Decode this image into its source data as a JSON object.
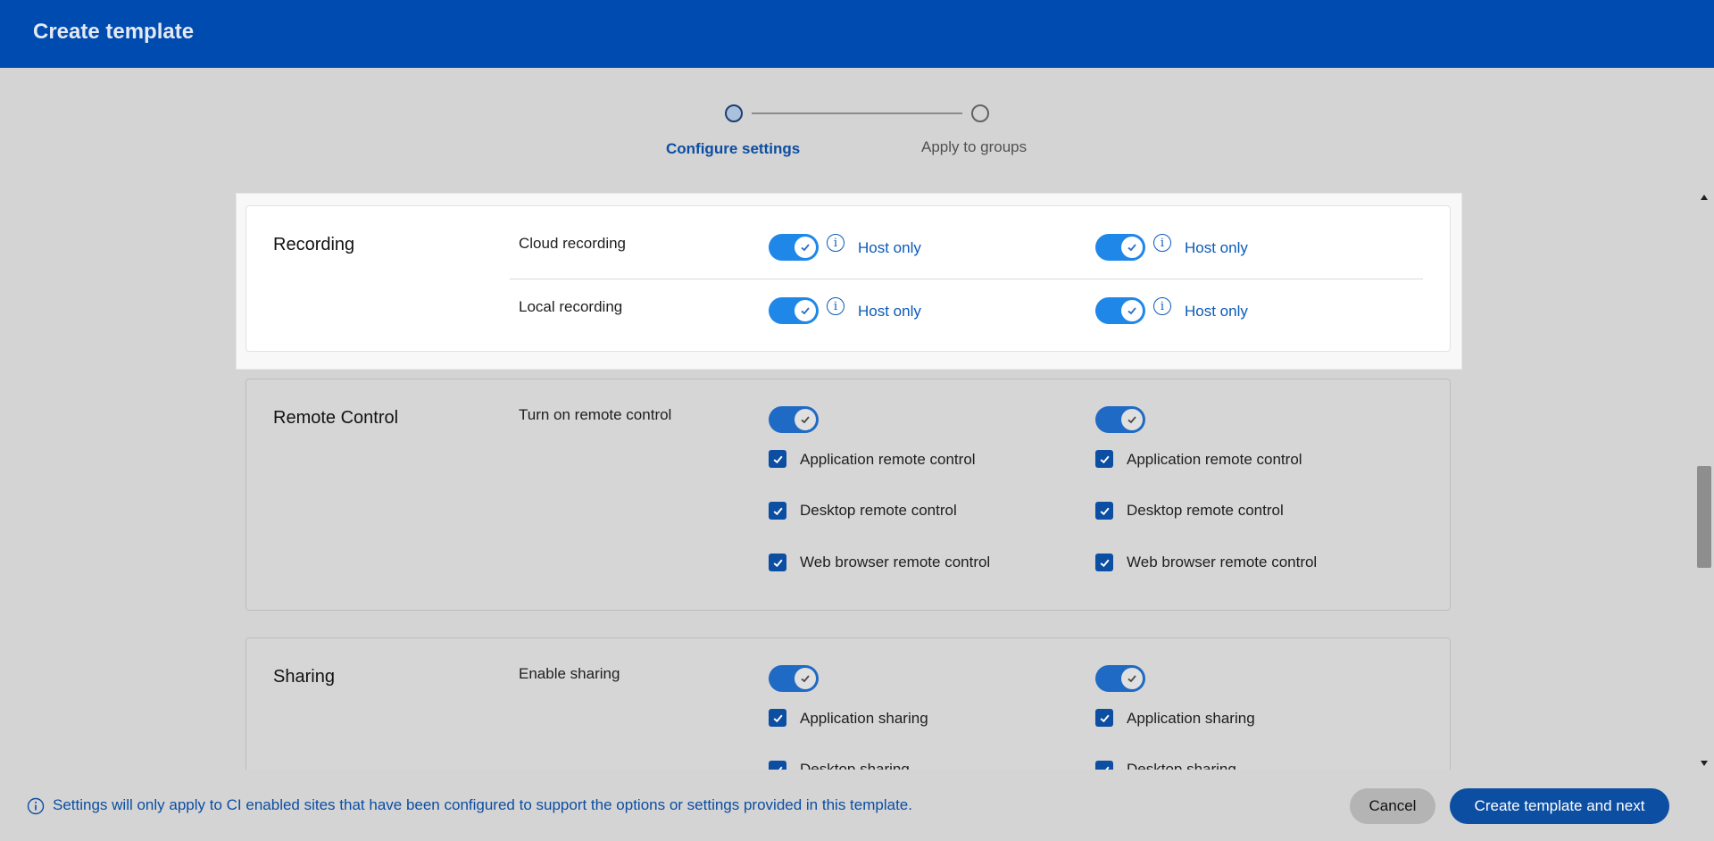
{
  "header": {
    "title": "Create template"
  },
  "stepper": {
    "steps": [
      {
        "label": "Configure settings",
        "active": true
      },
      {
        "label": "Apply to groups",
        "active": false
      }
    ]
  },
  "sections": {
    "recording": {
      "title": "Recording",
      "rows": [
        {
          "label": "Cloud recording",
          "col1": {
            "on": true,
            "link": "Host only"
          },
          "col2": {
            "on": true,
            "link": "Host only"
          }
        },
        {
          "label": "Local recording",
          "col1": {
            "on": true,
            "link": "Host only"
          },
          "col2": {
            "on": true,
            "link": "Host only"
          }
        }
      ]
    },
    "remote_control": {
      "title": "Remote Control",
      "toggle_label": "Turn on remote control",
      "options": [
        "Application remote control",
        "Desktop remote control",
        "Web browser remote control"
      ]
    },
    "sharing": {
      "title": "Sharing",
      "toggle_label": "Enable sharing",
      "options": [
        "Application sharing",
        "Desktop sharing"
      ]
    }
  },
  "footer": {
    "notice": "Settings will only apply to CI enabled sites that have been configured to support the options or settings provided in this template.",
    "cancel_label": "Cancel",
    "primary_label": "Create template and next"
  },
  "colors": {
    "header_bg": "#004bb0",
    "accent": "#0b4ea2",
    "toggle_on": "#1f87e8"
  }
}
